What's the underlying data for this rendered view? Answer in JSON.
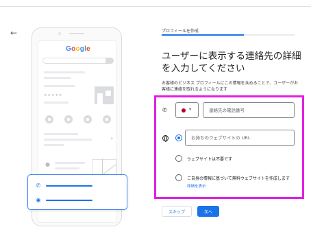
{
  "illustration": {
    "brand_letters": [
      "G",
      "o",
      "o",
      "g",
      "l",
      "e"
    ],
    "stars": "★★★★★"
  },
  "form": {
    "breadcrumb": "プロフィールを作成",
    "progress_fraction": 0.62,
    "heading": "ユーザーに表示する連絡先の詳細を入力してください",
    "description": "お客様のビジネス プロフィールにこの情報を含めることで、ユーザーがお客様に連絡を取れるようになります",
    "phone": {
      "icon": "phone-icon",
      "country_flag_color": "#bc002d",
      "placeholder": "連絡先の電話番号",
      "value": ""
    },
    "website": {
      "icon": "globe-icon",
      "placeholder": "お持ちのウェブサイトの URL",
      "value": "",
      "options": [
        {
          "label": "ウェブサイトは不要です",
          "selected": false
        },
        {
          "label": "ご自身の情報に基づいて無料ウェブサイトを作成します",
          "selected": false,
          "link": "詳細を表示"
        }
      ]
    }
  },
  "buttons": {
    "skip_label": "スキップ",
    "next_label": "次へ"
  },
  "colors": {
    "accent": "#1a73e8",
    "highlight": "#e120e1"
  }
}
